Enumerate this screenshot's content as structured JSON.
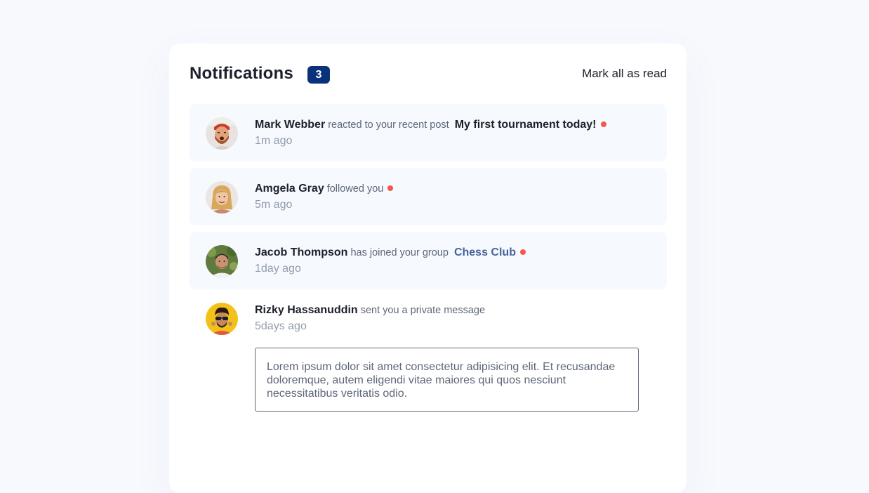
{
  "header": {
    "title": "Notifications",
    "unread_count": "3",
    "mark_all_label": "Mark all as read"
  },
  "colors": {
    "unread_bg": "#f6f9fe",
    "badge_bg": "#0a327b",
    "dot": "#f65552",
    "group_link": "#3f5d9c"
  },
  "notifications": [
    {
      "name": "Mark Webber",
      "action": "reacted to your recent post",
      "target": "My first tournament today!",
      "time": "1m ago"
    },
    {
      "name": "Amgela Gray",
      "action": "followed you",
      "time": "5m ago"
    },
    {
      "name": "Jacob Thompson",
      "action": "has joined your group",
      "target": "Chess Club",
      "time": "1day ago"
    },
    {
      "name": "Rizky Hassanuddin",
      "action": "sent you a private message",
      "time": "5days ago",
      "message": "Lorem ipsum dolor sit amet consectetur adipisicing elit. Et recusandae doloremque, autem eligendi vitae maiores qui quos nesciunt necessitatibus veritatis odio."
    }
  ]
}
